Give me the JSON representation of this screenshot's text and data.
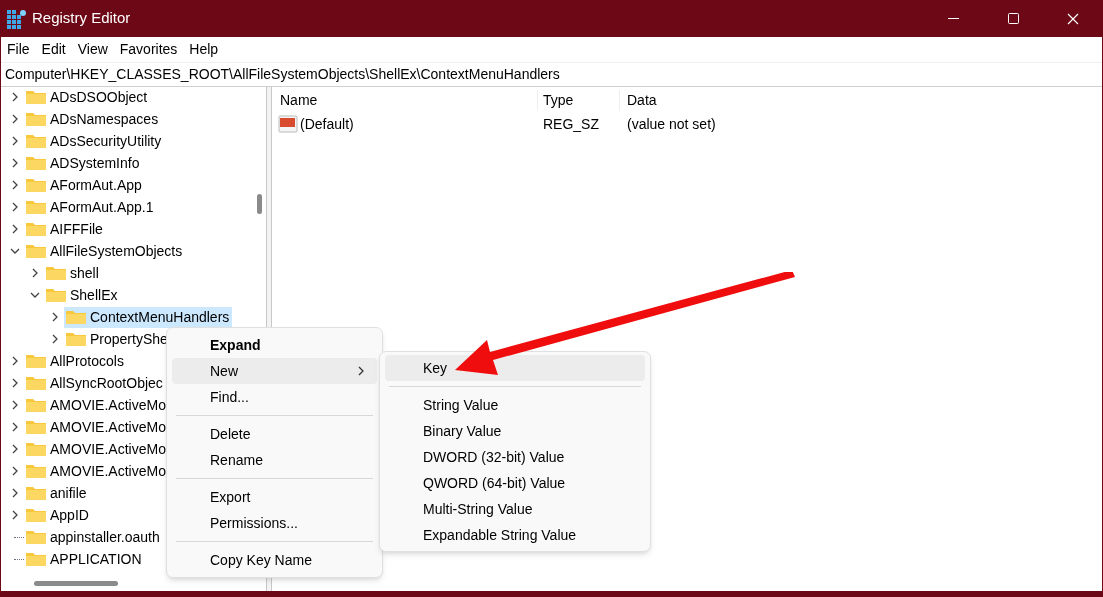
{
  "window": {
    "title": "Registry Editor"
  },
  "menu_bar": [
    "File",
    "Edit",
    "View",
    "Favorites",
    "Help"
  ],
  "address": "Computer\\HKEY_CLASSES_ROOT\\AllFileSystemObjects\\ShellEx\\ContextMenuHandlers",
  "tree": [
    {
      "label": "ADsDSOObject",
      "kind": "branch",
      "expanded": false,
      "selected": false
    },
    {
      "label": "ADsNamespaces",
      "kind": "branch",
      "expanded": false,
      "selected": false
    },
    {
      "label": "ADsSecurityUtility",
      "kind": "branch",
      "expanded": false,
      "selected": false
    },
    {
      "label": "ADSystemInfo",
      "kind": "branch",
      "expanded": false,
      "selected": false
    },
    {
      "label": "AFormAut.App",
      "kind": "branch",
      "expanded": false,
      "selected": false
    },
    {
      "label": "AFormAut.App.1",
      "kind": "branch",
      "expanded": false,
      "selected": false
    },
    {
      "label": "AIFFFile",
      "kind": "branch",
      "expanded": false,
      "selected": false
    },
    {
      "label": "AllFileSystemObjects",
      "kind": "branch",
      "expanded": true,
      "selected": false,
      "children": [
        {
          "label": "shell",
          "kind": "branch",
          "expanded": false,
          "selected": false
        },
        {
          "label": "ShellEx",
          "kind": "branch",
          "expanded": true,
          "selected": false,
          "children": [
            {
              "label": "ContextMenuHandlers",
              "kind": "branch",
              "expanded": false,
              "selected": true
            },
            {
              "label": "PropertyShe",
              "kind": "branch",
              "expanded": false,
              "selected": false
            }
          ]
        }
      ]
    },
    {
      "label": "AllProtocols",
      "kind": "branch",
      "expanded": false,
      "selected": false
    },
    {
      "label": "AllSyncRootObjec",
      "kind": "branch",
      "expanded": false,
      "selected": false
    },
    {
      "label": "AMOVIE.ActiveMo",
      "kind": "branch",
      "expanded": false,
      "selected": false
    },
    {
      "label": "AMOVIE.ActiveMo",
      "kind": "branch",
      "expanded": false,
      "selected": false
    },
    {
      "label": "AMOVIE.ActiveMo",
      "kind": "branch",
      "expanded": false,
      "selected": false
    },
    {
      "label": "AMOVIE.ActiveMo",
      "kind": "branch",
      "expanded": false,
      "selected": false
    },
    {
      "label": "anifile",
      "kind": "branch",
      "expanded": false,
      "selected": false
    },
    {
      "label": "AppID",
      "kind": "branch",
      "expanded": false,
      "selected": false
    },
    {
      "label": "appinstaller.oauth",
      "kind": "leaf",
      "selected": false
    },
    {
      "label": "APPLICATION",
      "kind": "leaf",
      "selected": false
    }
  ],
  "values": {
    "columns": [
      "Name",
      "Type",
      "Data"
    ],
    "rows": [
      {
        "name": "(Default)",
        "type": "REG_SZ",
        "data": "(value not set)"
      }
    ]
  },
  "context_menu": [
    {
      "kind": "item",
      "label": "Expand",
      "bold": true,
      "selected": false,
      "submenu": false
    },
    {
      "kind": "item",
      "label": "New",
      "bold": false,
      "selected": true,
      "submenu": true
    },
    {
      "kind": "item",
      "label": "Find...",
      "bold": false,
      "selected": false,
      "submenu": false
    },
    {
      "kind": "separator"
    },
    {
      "kind": "item",
      "label": "Delete",
      "bold": false,
      "selected": false,
      "submenu": false
    },
    {
      "kind": "item",
      "label": "Rename",
      "bold": false,
      "selected": false,
      "submenu": false
    },
    {
      "kind": "separator"
    },
    {
      "kind": "item",
      "label": "Export",
      "bold": false,
      "selected": false,
      "submenu": false
    },
    {
      "kind": "item",
      "label": "Permissions...",
      "bold": false,
      "selected": false,
      "submenu": false
    },
    {
      "kind": "separator"
    },
    {
      "kind": "item",
      "label": "Copy Key Name",
      "bold": false,
      "selected": false,
      "submenu": false
    }
  ],
  "submenu": [
    {
      "kind": "item",
      "label": "Key",
      "selected": true
    },
    {
      "kind": "separator"
    },
    {
      "kind": "item",
      "label": "String Value",
      "selected": false
    },
    {
      "kind": "item",
      "label": "Binary Value",
      "selected": false
    },
    {
      "kind": "item",
      "label": "DWORD (32-bit) Value",
      "selected": false
    },
    {
      "kind": "item",
      "label": "QWORD (64-bit) Value",
      "selected": false
    },
    {
      "kind": "item",
      "label": "Multi-String Value",
      "selected": false
    },
    {
      "kind": "item",
      "label": "Expandable String Value",
      "selected": false
    }
  ]
}
